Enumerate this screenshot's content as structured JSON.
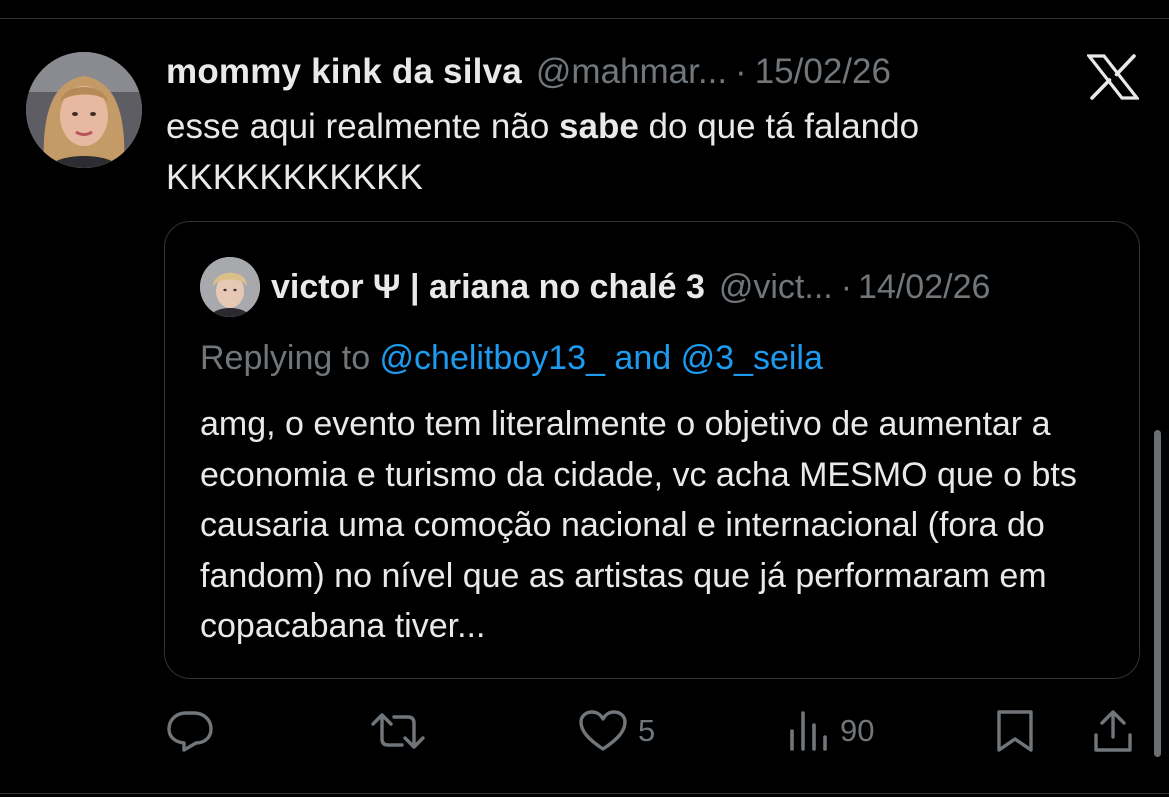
{
  "tweet": {
    "author_name": "mommy kink da silva",
    "author_handle": "@mahmar...",
    "separator": "·",
    "date": "15/02/26",
    "text_part1": "esse aqui realmente não ",
    "text_bold": "sabe",
    "text_part2": " do que tá falando",
    "text_line2": "KKKKKKKKKKK"
  },
  "quoted_tweet": {
    "author_name": "victor Ψ | ariana no chalé 3",
    "author_handle": "@vict...",
    "separator": "·",
    "date": "14/02/26",
    "replying_prefix": "Replying to ",
    "replying_mention_1": "@chelitboy13_",
    "replying_and": " and ",
    "replying_mention_2": "@3_seila",
    "text": "amg, o evento tem literalmente o objetivo de aumentar a economia e turismo da cidade, vc acha MESMO que o bts causaria uma comoção nacional e internacional (fora do fandom) no nível que as artistas que já performaram em copacabana tiver..."
  },
  "actions": {
    "reply_count": "",
    "retweet_count": "",
    "like_count": "5",
    "views_count": "90"
  },
  "icons": {
    "brand": "x-logo-icon",
    "reply": "reply-icon",
    "retweet": "retweet-icon",
    "like": "heart-icon",
    "views": "views-icon",
    "bookmark": "bookmark-icon",
    "share": "share-icon"
  },
  "colors": {
    "background": "#000000",
    "text_primary": "#e7e9ea",
    "text_secondary": "#71767b",
    "accent": "#1d9bf0",
    "border": "#2f3336"
  }
}
